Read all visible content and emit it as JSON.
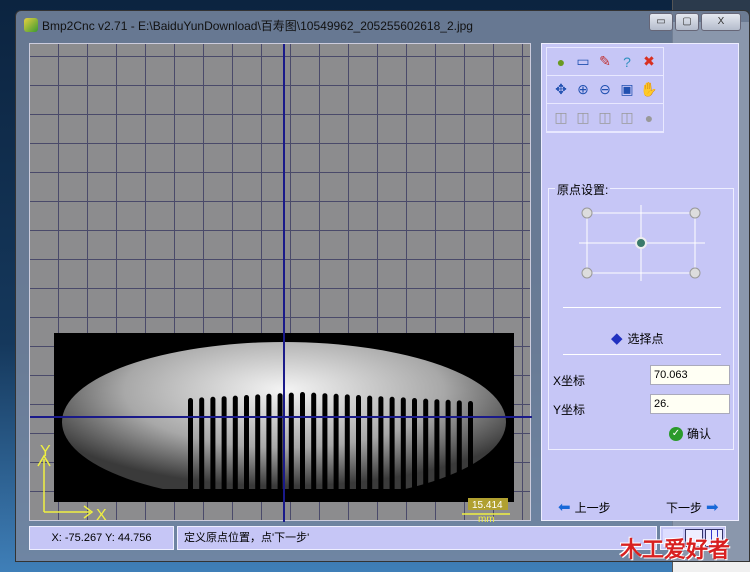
{
  "window": {
    "title": "Bmp2Cnc v2.71 - E:\\BaiduYunDownload\\百寿图\\10549962_205255602618_2.jpg",
    "minimize": "▭",
    "maximize": "▢",
    "close": "X"
  },
  "toolbar": {
    "rows": [
      [
        "open-icon",
        "save-icon",
        "tools-icon",
        "help-icon",
        "exit-icon"
      ],
      [
        "center-icon",
        "zoom-in-icon",
        "zoom-out-icon",
        "fit-icon",
        "pan-hand-icon"
      ],
      [
        "view-cube-icon",
        "view-front-icon",
        "view-side-icon",
        "view-back-icon",
        "render-icon"
      ]
    ]
  },
  "canvas": {
    "scale_value": "15.414",
    "scale_unit": "mm",
    "axis_x": "X",
    "axis_y": "Y"
  },
  "origin": {
    "label": "原点设置:",
    "select_point": "选择点",
    "x_label": "X坐标",
    "x_value": "70.063",
    "y_label": "Y坐标",
    "y_value": "26.",
    "confirm": "确认"
  },
  "nav": {
    "prev": "上一步",
    "next": "下一步"
  },
  "status": {
    "coords": "X: -75.267 Y: 44.756",
    "message": "定义原点位置，点'下一步'"
  },
  "watermark": "木工爱好者",
  "colors": {
    "panel": "#c6c6f6",
    "crosshair": "#1a1a8a",
    "grid": "#8c8c8e"
  }
}
